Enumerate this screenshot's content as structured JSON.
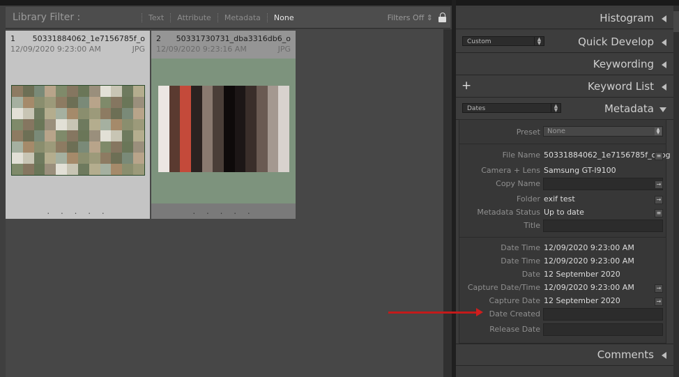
{
  "filter_bar": {
    "title": "Library Filter :",
    "options": [
      "Text",
      "Attribute",
      "Metadata",
      "None"
    ],
    "selected": "None",
    "filters_status": "Filters Off"
  },
  "grid": {
    "cells": [
      {
        "index": "1",
        "filename": "50331884062_1e7156785f_o",
        "date": "12/09/2020 9:23:00 AM",
        "ext": "JPG",
        "dots": ". . . . ."
      },
      {
        "index": "2",
        "filename": "50331730731_dba3316db6_o",
        "date": "12/09/2020 9:23:16 AM",
        "ext": "JPG",
        "dots": ". . . . ."
      }
    ]
  },
  "panels": {
    "histogram": "Histogram",
    "quick_develop": {
      "title": "Quick Develop",
      "preset": "Custom"
    },
    "keywording": "Keywording",
    "keyword_list": "Keyword List",
    "metadata": {
      "title": "Metadata",
      "view": "Dates"
    },
    "comments": "Comments"
  },
  "metadata": {
    "preset_label": "Preset",
    "preset_value": "None",
    "rows": {
      "file_name": {
        "label": "File Name",
        "value": "50331884062_1e7156785f_o.jpg"
      },
      "camera": {
        "label": "Camera + Lens",
        "value": "Samsung GT-I9100"
      },
      "copy_name": {
        "label": "Copy Name",
        "value": ""
      },
      "folder": {
        "label": "Folder",
        "value": "exif test"
      },
      "status": {
        "label": "Metadata Status",
        "value": "Up to date"
      },
      "title": {
        "label": "Title",
        "value": ""
      },
      "date_time_1": {
        "label": "Date Time",
        "value": "12/09/2020 9:23:00 AM"
      },
      "date_time_2": {
        "label": "Date Time",
        "value": "12/09/2020 9:23:00 AM"
      },
      "date": {
        "label": "Date",
        "value": "12 September 2020"
      },
      "capture_date_time": {
        "label": "Capture Date/Time",
        "value": "12/09/2020 9:23:00 AM"
      },
      "capture_date": {
        "label": "Capture Date",
        "value": "12 September 2020"
      },
      "date_created": {
        "label": "Date Created",
        "value": ""
      },
      "release_date": {
        "label": "Release Date",
        "value": ""
      }
    }
  },
  "colors": {
    "annotation_arrow": "#c41a1a",
    "accent_green": "#7d937d"
  }
}
